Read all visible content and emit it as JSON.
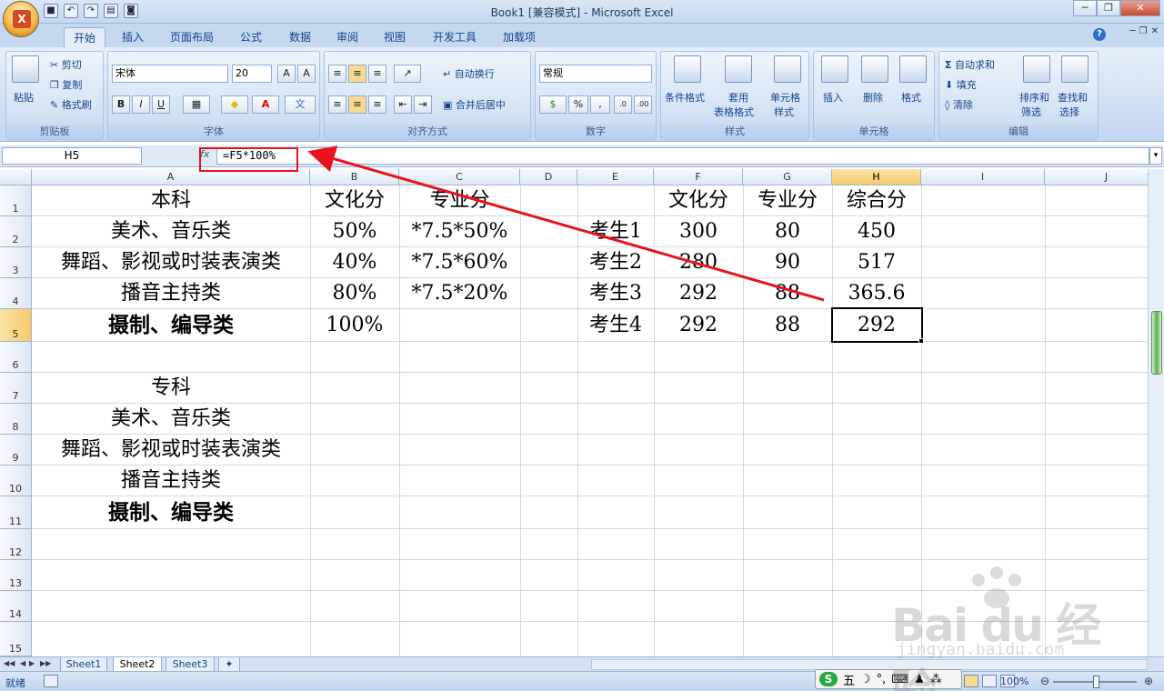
{
  "window": {
    "title": "Book1  [兼容模式] - Microsoft Excel"
  },
  "tabs": [
    "开始",
    "插入",
    "页面布局",
    "公式",
    "数据",
    "审阅",
    "视图",
    "开发工具",
    "加载项"
  ],
  "ribbon": {
    "clipboard": {
      "paste": "粘贴",
      "cut": "剪切",
      "copy": "复制",
      "format_painter": "格式刷",
      "label": "剪贴板"
    },
    "font": {
      "name": "宋体",
      "size": "20",
      "label": "字体",
      "bold": "B",
      "italic": "I",
      "underline": "U"
    },
    "alignment": {
      "wrap": "自动换行",
      "merge": "合并后居中",
      "label": "对齐方式"
    },
    "number": {
      "format": "常规",
      "percent": "%",
      "comma": ",",
      "label": "数字"
    },
    "styles": {
      "conditional": "条件格式",
      "table1": "套用",
      "table2": "表格格式",
      "cell1": "单元格",
      "cell2": "样式",
      "label": "样式"
    },
    "cells": {
      "insert": "插入",
      "delete": "删除",
      "format": "格式",
      "label": "单元格"
    },
    "editing": {
      "autosum": "自动求和",
      "fill": "填充",
      "clear": "清除",
      "sort1": "排序和",
      "sort2": "筛选",
      "find1": "查找和",
      "find2": "选择",
      "label": "编辑"
    }
  },
  "formula_bar": {
    "name_box": "H5",
    "fx": "fx",
    "formula": "=F5*100%"
  },
  "columns": [
    "A",
    "B",
    "C",
    "D",
    "E",
    "F",
    "G",
    "H",
    "I",
    "J"
  ],
  "rows": [
    "1",
    "2",
    "3",
    "4",
    "5",
    "6",
    "7",
    "8",
    "9",
    "10",
    "11",
    "12",
    "13",
    "14",
    "15"
  ],
  "cells": {
    "A1": "本科",
    "B1": "文化分",
    "C1": "专业分",
    "F1": "文化分",
    "G1": "专业分",
    "H1": "综合分",
    "A2": "美术、音乐类",
    "B2": "50%",
    "C2": "*7.5*50%",
    "E2": "考生1",
    "F2": "300",
    "G2": "80",
    "H2": "450",
    "A3": "舞蹈、影视或时装表演类",
    "B3": "40%",
    "C3": "*7.5*60%",
    "E3": "考生2",
    "F3": "280",
    "G3": "90",
    "H3": "517",
    "A4": "播音主持类",
    "B4": "80%",
    "C4": "*7.5*20%",
    "E4": "考生3",
    "F4": "292",
    "G4": "88",
    "H4": "365.6",
    "A5": "摄制、编导类",
    "B5": "100%",
    "E5": "考生4",
    "F5": "292",
    "G5": "88",
    "H5": "292",
    "A7": "专科",
    "A8": "美术、音乐类",
    "A9": "舞蹈、影视或时装表演类",
    "A10": "播音主持类",
    "A11": "摄制、编导类"
  },
  "sheets": [
    "Sheet1",
    "Sheet2",
    "Sheet3"
  ],
  "active_sheet": "Sheet2",
  "status": {
    "ready": "就绪",
    "zoom": "100%"
  },
  "ime": {
    "mode": "五"
  },
  "watermark": {
    "brand": "Bai du 经验",
    "url": "jingyan.baidu.com"
  },
  "colors": {
    "annotation": "#e8141c",
    "ribbon": "#cedff4",
    "selected_header": "#f7c96a"
  }
}
